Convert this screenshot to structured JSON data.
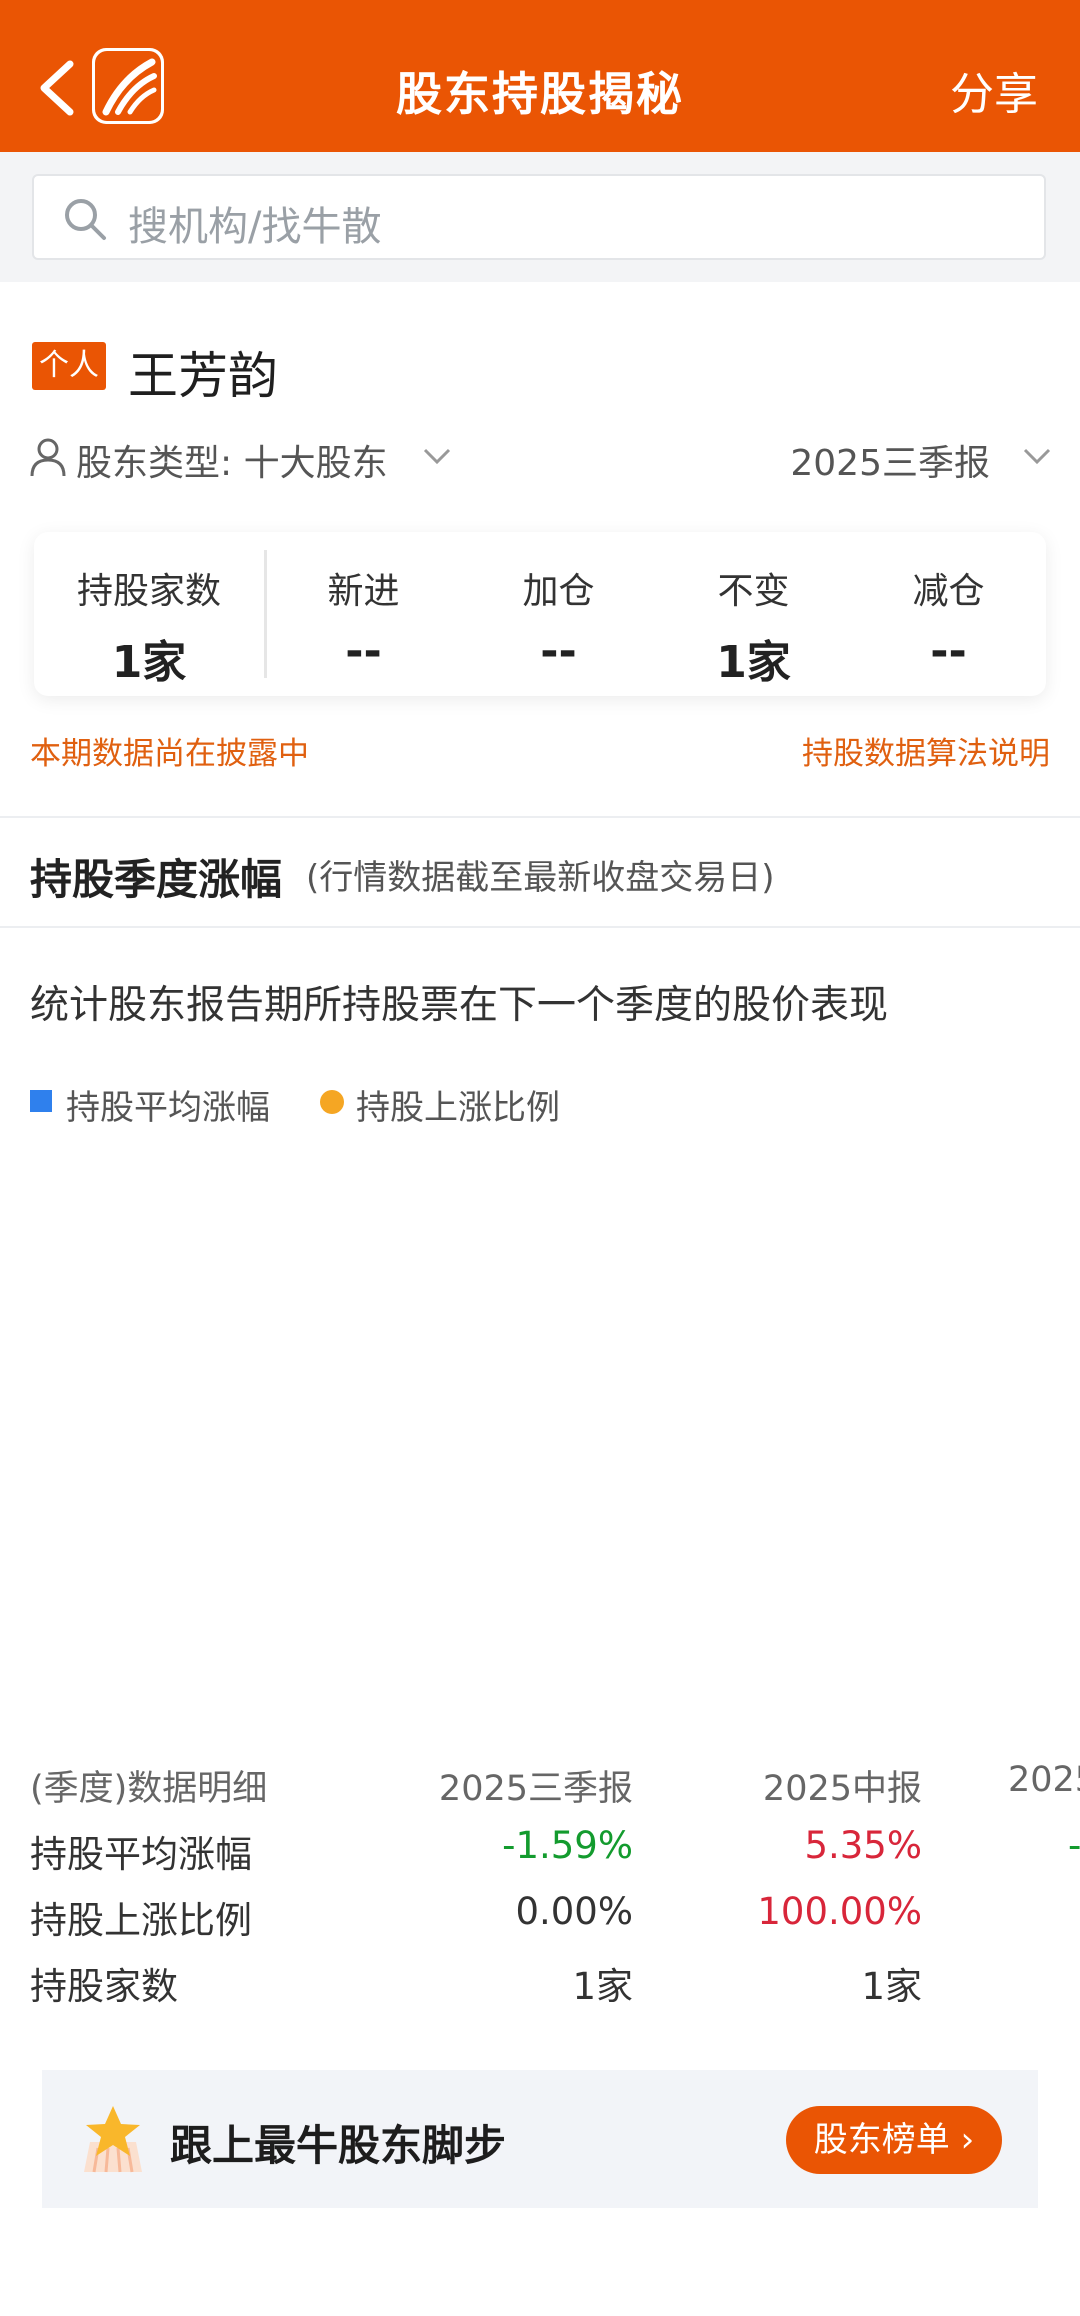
{
  "header": {
    "title": "股东持股揭秘",
    "share_label": "分享"
  },
  "search": {
    "placeholder": "搜机构/找牛散"
  },
  "profile": {
    "badge": "个人",
    "name": "王芳韵",
    "shareholder_type": "股东类型: 十大股东",
    "period": "2025三季报"
  },
  "stats": [
    {
      "label": "持股家数",
      "value": "1家"
    },
    {
      "label": "新进",
      "value": "--"
    },
    {
      "label": "加仓",
      "value": "--"
    },
    {
      "label": "不变",
      "value": "1家"
    },
    {
      "label": "减仓",
      "value": "--"
    }
  ],
  "notes": {
    "left": "本期数据尚在披露中",
    "right": "持股数据算法说明"
  },
  "section": {
    "title": "持股季度涨幅",
    "subtitle": "(行情数据截至最新收盘交易日)",
    "description": "统计股东报告期所持股票在下一个季度的股价表现"
  },
  "legend": [
    {
      "label": "持股平均涨幅",
      "color": "#2f80ed"
    },
    {
      "label": "持股上涨比例",
      "color": "#f5a623"
    }
  ],
  "table": {
    "header_label": "(季度)数据明细",
    "columns": [
      "2025三季报",
      "2025中报",
      "2025"
    ],
    "rows": [
      {
        "label": "持股平均涨幅",
        "values": [
          "-1.59%",
          "5.35%",
          "-"
        ]
      },
      {
        "label": "持股上涨比例",
        "values": [
          "0.00%",
          "100.00%",
          ""
        ]
      },
      {
        "label": "持股家数",
        "values": [
          "1家",
          "1家",
          ""
        ]
      }
    ]
  },
  "banner": {
    "text": "跟上最牛股东脚步",
    "button_label": "股东榜单"
  },
  "colors": {
    "brand": "#ea5504",
    "up": "#d8263a",
    "down": "#139b2e"
  }
}
